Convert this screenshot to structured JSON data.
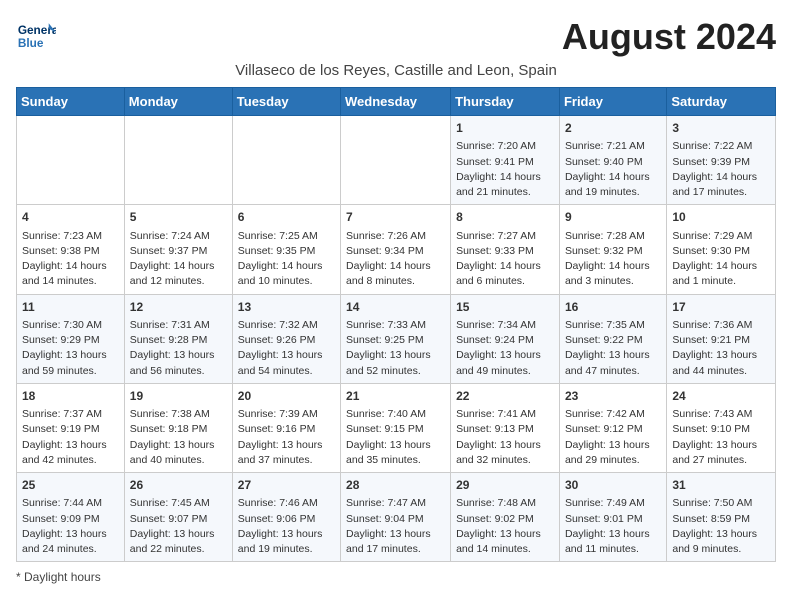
{
  "header": {
    "logo_line1": "General",
    "logo_line2": "Blue",
    "title": "August 2024",
    "subtitle": "Villaseco de los Reyes, Castille and Leon, Spain"
  },
  "weekdays": [
    "Sunday",
    "Monday",
    "Tuesday",
    "Wednesday",
    "Thursday",
    "Friday",
    "Saturday"
  ],
  "weeks": [
    [
      {
        "day": "",
        "info": ""
      },
      {
        "day": "",
        "info": ""
      },
      {
        "day": "",
        "info": ""
      },
      {
        "day": "",
        "info": ""
      },
      {
        "day": "1",
        "info": "Sunrise: 7:20 AM\nSunset: 9:41 PM\nDaylight: 14 hours\nand 21 minutes."
      },
      {
        "day": "2",
        "info": "Sunrise: 7:21 AM\nSunset: 9:40 PM\nDaylight: 14 hours\nand 19 minutes."
      },
      {
        "day": "3",
        "info": "Sunrise: 7:22 AM\nSunset: 9:39 PM\nDaylight: 14 hours\nand 17 minutes."
      }
    ],
    [
      {
        "day": "4",
        "info": "Sunrise: 7:23 AM\nSunset: 9:38 PM\nDaylight: 14 hours\nand 14 minutes."
      },
      {
        "day": "5",
        "info": "Sunrise: 7:24 AM\nSunset: 9:37 PM\nDaylight: 14 hours\nand 12 minutes."
      },
      {
        "day": "6",
        "info": "Sunrise: 7:25 AM\nSunset: 9:35 PM\nDaylight: 14 hours\nand 10 minutes."
      },
      {
        "day": "7",
        "info": "Sunrise: 7:26 AM\nSunset: 9:34 PM\nDaylight: 14 hours\nand 8 minutes."
      },
      {
        "day": "8",
        "info": "Sunrise: 7:27 AM\nSunset: 9:33 PM\nDaylight: 14 hours\nand 6 minutes."
      },
      {
        "day": "9",
        "info": "Sunrise: 7:28 AM\nSunset: 9:32 PM\nDaylight: 14 hours\nand 3 minutes."
      },
      {
        "day": "10",
        "info": "Sunrise: 7:29 AM\nSunset: 9:30 PM\nDaylight: 14 hours\nand 1 minute."
      }
    ],
    [
      {
        "day": "11",
        "info": "Sunrise: 7:30 AM\nSunset: 9:29 PM\nDaylight: 13 hours\nand 59 minutes."
      },
      {
        "day": "12",
        "info": "Sunrise: 7:31 AM\nSunset: 9:28 PM\nDaylight: 13 hours\nand 56 minutes."
      },
      {
        "day": "13",
        "info": "Sunrise: 7:32 AM\nSunset: 9:26 PM\nDaylight: 13 hours\nand 54 minutes."
      },
      {
        "day": "14",
        "info": "Sunrise: 7:33 AM\nSunset: 9:25 PM\nDaylight: 13 hours\nand 52 minutes."
      },
      {
        "day": "15",
        "info": "Sunrise: 7:34 AM\nSunset: 9:24 PM\nDaylight: 13 hours\nand 49 minutes."
      },
      {
        "day": "16",
        "info": "Sunrise: 7:35 AM\nSunset: 9:22 PM\nDaylight: 13 hours\nand 47 minutes."
      },
      {
        "day": "17",
        "info": "Sunrise: 7:36 AM\nSunset: 9:21 PM\nDaylight: 13 hours\nand 44 minutes."
      }
    ],
    [
      {
        "day": "18",
        "info": "Sunrise: 7:37 AM\nSunset: 9:19 PM\nDaylight: 13 hours\nand 42 minutes."
      },
      {
        "day": "19",
        "info": "Sunrise: 7:38 AM\nSunset: 9:18 PM\nDaylight: 13 hours\nand 40 minutes."
      },
      {
        "day": "20",
        "info": "Sunrise: 7:39 AM\nSunset: 9:16 PM\nDaylight: 13 hours\nand 37 minutes."
      },
      {
        "day": "21",
        "info": "Sunrise: 7:40 AM\nSunset: 9:15 PM\nDaylight: 13 hours\nand 35 minutes."
      },
      {
        "day": "22",
        "info": "Sunrise: 7:41 AM\nSunset: 9:13 PM\nDaylight: 13 hours\nand 32 minutes."
      },
      {
        "day": "23",
        "info": "Sunrise: 7:42 AM\nSunset: 9:12 PM\nDaylight: 13 hours\nand 29 minutes."
      },
      {
        "day": "24",
        "info": "Sunrise: 7:43 AM\nSunset: 9:10 PM\nDaylight: 13 hours\nand 27 minutes."
      }
    ],
    [
      {
        "day": "25",
        "info": "Sunrise: 7:44 AM\nSunset: 9:09 PM\nDaylight: 13 hours\nand 24 minutes."
      },
      {
        "day": "26",
        "info": "Sunrise: 7:45 AM\nSunset: 9:07 PM\nDaylight: 13 hours\nand 22 minutes."
      },
      {
        "day": "27",
        "info": "Sunrise: 7:46 AM\nSunset: 9:06 PM\nDaylight: 13 hours\nand 19 minutes."
      },
      {
        "day": "28",
        "info": "Sunrise: 7:47 AM\nSunset: 9:04 PM\nDaylight: 13 hours\nand 17 minutes."
      },
      {
        "day": "29",
        "info": "Sunrise: 7:48 AM\nSunset: 9:02 PM\nDaylight: 13 hours\nand 14 minutes."
      },
      {
        "day": "30",
        "info": "Sunrise: 7:49 AM\nSunset: 9:01 PM\nDaylight: 13 hours\nand 11 minutes."
      },
      {
        "day": "31",
        "info": "Sunrise: 7:50 AM\nSunset: 8:59 PM\nDaylight: 13 hours\nand 9 minutes."
      }
    ]
  ],
  "footer": {
    "note": "Daylight hours"
  }
}
